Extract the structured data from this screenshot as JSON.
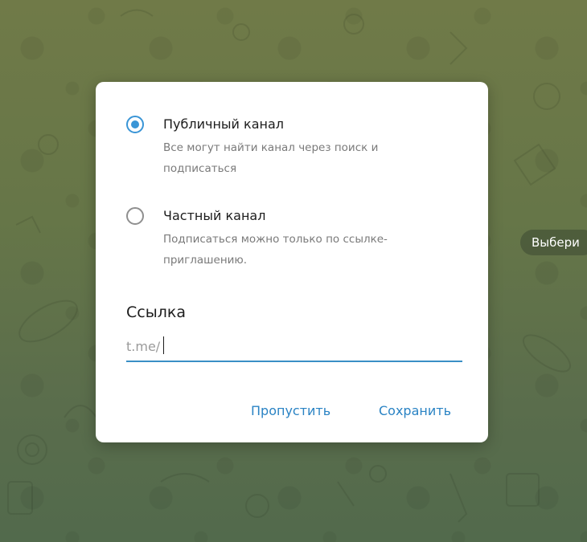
{
  "background": {
    "side_chip_text": "Выбери"
  },
  "dialog": {
    "options": [
      {
        "title": "Публичный канал",
        "description": "Все могут найти канал через поиск и подписаться",
        "selected": true
      },
      {
        "title": "Частный канал",
        "description": "Подписаться можно только по ссылке-приглашению.",
        "selected": false
      }
    ],
    "link": {
      "label": "Ссылка",
      "value": "t.me/"
    },
    "buttons": {
      "skip_label": "Пропустить",
      "save_label": "Сохранить"
    }
  },
  "colors": {
    "accent": "#3a95d6",
    "button_text": "#2a83c4",
    "underline": "#3a8fc6"
  }
}
